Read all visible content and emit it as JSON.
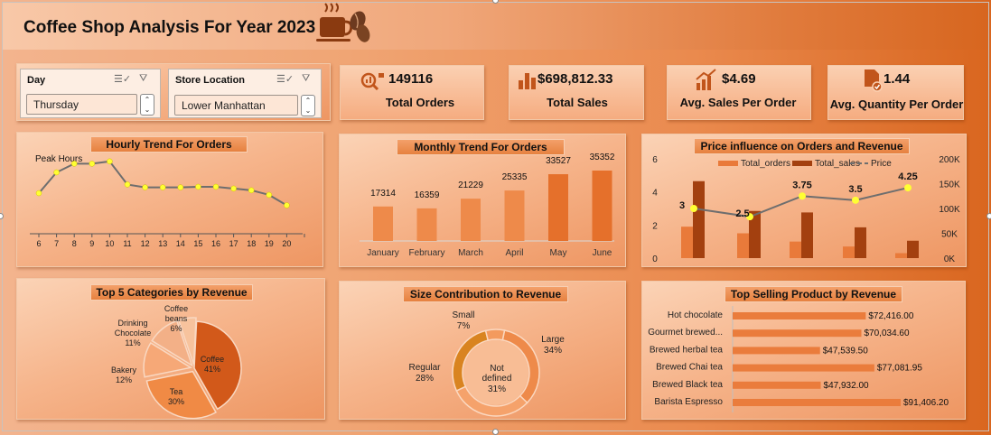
{
  "dashboard": {
    "title": "Coffee Shop Analysis For Year 2023"
  },
  "slicers": [
    {
      "label": "Day",
      "value": "Thursday"
    },
    {
      "label": "Store Location",
      "value": "Lower Manhattan"
    }
  ],
  "kpis": [
    {
      "value": "149116",
      "label": "Total Orders",
      "icon": "search-chart-icon"
    },
    {
      "value": "$698,812.33",
      "label": "Total Sales",
      "icon": "bar-chart-icon"
    },
    {
      "value": "$4.69",
      "label": "Avg. Sales Per Order",
      "icon": "growth-chart-icon"
    },
    {
      "value": "1.44",
      "label": "Avg. Quantity Per Order",
      "icon": "document-check-icon"
    }
  ],
  "colors": {
    "accent": "#e6813f",
    "bar_light": "#e97a3a",
    "bar_dark": "#a3400f",
    "line": "#6e6e6e",
    "marker": "#ffff33"
  },
  "chart_data": [
    {
      "type": "line",
      "title": "Hourly Trend For Orders",
      "annotation": "Peak Hours",
      "x": [
        6,
        7,
        8,
        9,
        10,
        11,
        12,
        13,
        14,
        15,
        16,
        17,
        18,
        19,
        20
      ],
      "values": [
        6400,
        10000,
        11500,
        11500,
        11900,
        7900,
        7400,
        7400,
        7400,
        7500,
        7500,
        7200,
        6900,
        6100,
        4300
      ]
    },
    {
      "type": "bar",
      "title": "Monthly Trend For Orders",
      "categories": [
        "January",
        "February",
        "March",
        "April",
        "May",
        "June"
      ],
      "values": [
        17314,
        16359,
        21229,
        25335,
        33527,
        35352
      ]
    },
    {
      "type": "bar",
      "title": "Price influence on Orders and Revenue",
      "legend": [
        "Total_orders",
        "Total_sales",
        "Price"
      ],
      "yleft_ticks": [
        "0",
        "2",
        "4",
        "6"
      ],
      "yright_ticks": [
        "0K",
        "50K",
        "100K",
        "150K",
        "200K"
      ],
      "series": [
        {
          "name": "Total_orders",
          "values": [
            1.9,
            1.5,
            1.0,
            0.7,
            0.3
          ]
        },
        {
          "name": "Total_sales",
          "values": [
            155000,
            95000,
            92000,
            62000,
            35000
          ]
        },
        {
          "name": "Price",
          "values": [
            3,
            2.5,
            3.75,
            3.5,
            4.25
          ]
        }
      ],
      "price_labels": [
        "3",
        "2.5",
        "3.75",
        "3.5",
        "4.25"
      ]
    },
    {
      "type": "pie",
      "title": "Top 5 Categories by Revenue",
      "slices": [
        {
          "label": "Coffee",
          "pct": "41%",
          "value": 41
        },
        {
          "label": "Tea",
          "pct": "30%",
          "value": 30
        },
        {
          "label": "Bakery",
          "pct": "12%",
          "value": 12
        },
        {
          "label": "Drinking Chocolate",
          "pct": "11%",
          "value": 11
        },
        {
          "label": "Coffee beans",
          "pct": "6%",
          "value": 6
        }
      ]
    },
    {
      "type": "pie",
      "title": "Size Contribution to Revenue",
      "slices": [
        {
          "label": "Large",
          "pct": "34%",
          "value": 34
        },
        {
          "label": "Not defined",
          "pct": "31%",
          "value": 31
        },
        {
          "label": "Regular",
          "pct": "28%",
          "value": 28
        },
        {
          "label": "Small",
          "pct": "7%",
          "value": 7
        }
      ]
    },
    {
      "type": "bar",
      "title": "Top Selling Product by Revenue",
      "categories": [
        "Hot chocolate",
        "Gourmet brewed...",
        "Brewed herbal tea",
        "Brewed Chai tea",
        "Brewed Black tea",
        "Barista Espresso"
      ],
      "values": [
        72416.0,
        70034.6,
        47539.5,
        77081.95,
        47932.0,
        91406.2
      ],
      "labels": [
        "$72,416.00",
        "$70,034.60",
        "$47,539.50",
        "$77,081.95",
        "$47,932.00",
        "$91,406.20"
      ]
    }
  ]
}
